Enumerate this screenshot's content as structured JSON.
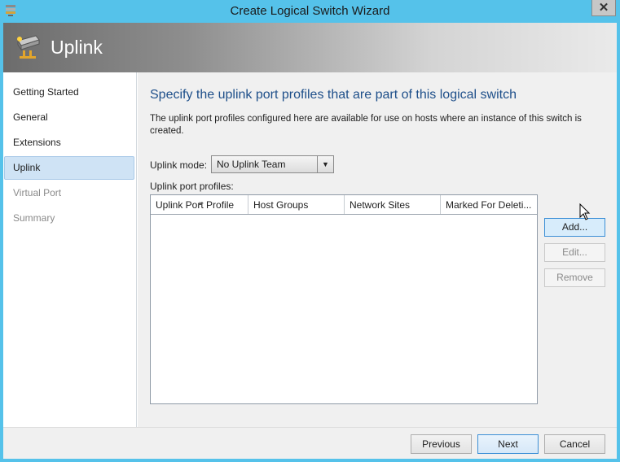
{
  "window": {
    "title": "Create Logical Switch Wizard",
    "close_glyph": "✕",
    "icon": "server-stack-icon"
  },
  "header": {
    "title": "Uplink",
    "icon": "switch-uplink-icon"
  },
  "nav": {
    "items": [
      {
        "label": "Getting Started",
        "state": "normal"
      },
      {
        "label": "General",
        "state": "normal"
      },
      {
        "label": "Extensions",
        "state": "normal"
      },
      {
        "label": "Uplink",
        "state": "selected"
      },
      {
        "label": "Virtual Port",
        "state": "disabled"
      },
      {
        "label": "Summary",
        "state": "disabled"
      }
    ]
  },
  "main": {
    "heading": "Specify the uplink port profiles that are part of this logical switch",
    "description": "The uplink port profiles configured here are available for use on hosts where an instance of this switch is created.",
    "uplink_mode_label": "Uplink mode:",
    "uplink_mode_value": "No Uplink Team",
    "profiles_label": "Uplink port profiles:",
    "columns": [
      "Uplink Port Profile",
      "Host Groups",
      "Network Sites",
      "Marked For Deleti..."
    ],
    "rows": [],
    "buttons": {
      "add": "Add...",
      "edit": "Edit...",
      "remove": "Remove"
    }
  },
  "footer": {
    "previous": "Previous",
    "next": "Next",
    "cancel": "Cancel"
  },
  "colors": {
    "title_bar": "#55c2ea",
    "heading": "#1e4f8a",
    "selected_nav": "#cfe3f5"
  }
}
